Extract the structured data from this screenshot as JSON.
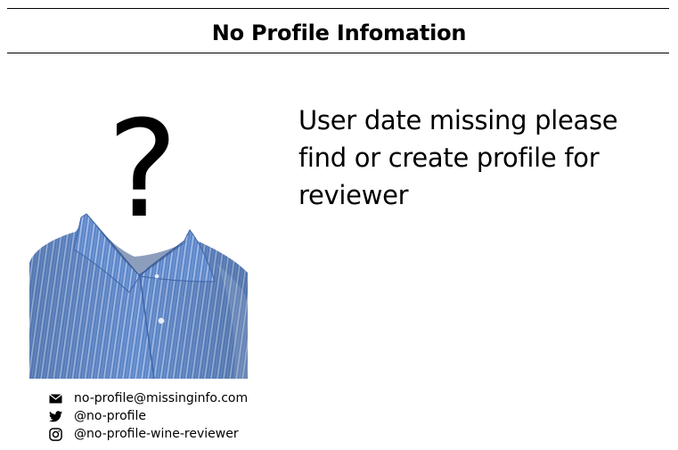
{
  "header": {
    "title": "No Profile Infomation"
  },
  "avatar": {
    "glyph": "?",
    "icon": "unknown-person-shirt"
  },
  "main": {
    "message": "User date missing please find or create profile for reviewer"
  },
  "contacts": {
    "email": {
      "icon": "envelope-icon",
      "value": "no-profile@missinginfo.com"
    },
    "twitter": {
      "icon": "twitter-icon",
      "value": "@no-profile"
    },
    "instagram": {
      "icon": "instagram-icon",
      "value": "@no-profile-wine-reviewer"
    }
  },
  "colors": {
    "shirt": "#5b85c8",
    "shirt_stripe": "#a9c2ea",
    "text": "#000000"
  }
}
